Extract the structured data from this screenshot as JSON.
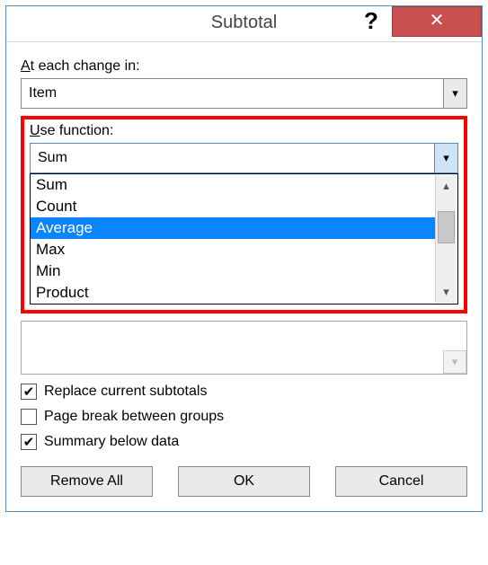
{
  "title": "Subtotal",
  "labels": {
    "at_change_pre": "A",
    "at_change_rest": "t each change in:",
    "use_function_pre": "U",
    "use_function_rest": "se function:"
  },
  "change_combo": {
    "value": "Item"
  },
  "function_combo": {
    "value": "Sum"
  },
  "function_options": [
    "Sum",
    "Count",
    "Average",
    "Max",
    "Min",
    "Product"
  ],
  "selected_option_index": 2,
  "checks": {
    "replace": {
      "checked": true,
      "label_pre": "Replace ",
      "label_u": "c",
      "label_rest": "urrent subtotals"
    },
    "pagebreak": {
      "checked": false,
      "label_u": "P",
      "label_rest": "age break between groups"
    },
    "summary": {
      "checked": true,
      "label_u": "S",
      "label_rest": "ummary below data"
    }
  },
  "buttons": {
    "remove_u": "R",
    "remove_rest": "emove All",
    "ok": "OK",
    "cancel": "Cancel"
  },
  "glyphs": {
    "help": "?",
    "close": "✕",
    "chev_down": "▾",
    "chev_up": "▴",
    "check": "✔"
  }
}
